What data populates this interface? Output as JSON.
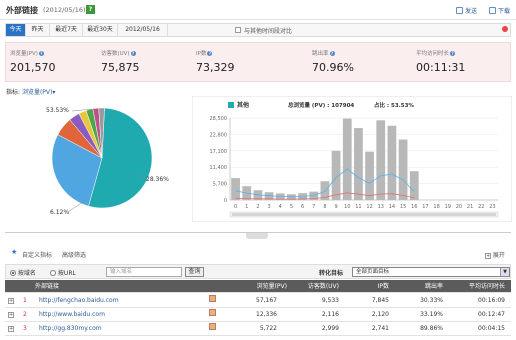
{
  "header": {
    "title": "外部链接",
    "date": "(2012/05/16)",
    "help": "?",
    "send": "发送",
    "download": "下载"
  },
  "datebar": {
    "tabs": [
      "今天",
      "昨天",
      "最近7天",
      "最近30天",
      "2012/05/16"
    ],
    "active": 0,
    "compare_label": "与其他时间段对比"
  },
  "metrics": [
    {
      "label": "浏览量(PV)",
      "value": "201,570"
    },
    {
      "label": "访客数(UV)",
      "value": "75,875"
    },
    {
      "label": "IP数",
      "value": "73,329"
    },
    {
      "label": "跳出率",
      "value": "70.96%"
    },
    {
      "label": "平均访问时长",
      "value": "00:11:31"
    }
  ],
  "indicator": {
    "label": "指标:",
    "value": "浏览量(PV)▾"
  },
  "pie": {
    "labels": [
      "53.53%",
      "28.36%",
      "6.12%"
    ],
    "slices": [
      {
        "value": 53.53,
        "color": "#1faab0"
      },
      {
        "value": 28.36,
        "color": "#4fa6e0"
      },
      {
        "value": 6.12,
        "color": "#e0653a"
      },
      {
        "value": 3.5,
        "color": "#8a5cc0"
      },
      {
        "value": 2.5,
        "color": "#e8c53a"
      },
      {
        "value": 2.2,
        "color": "#4aa84a"
      },
      {
        "value": 1.9,
        "color": "#c0508a"
      },
      {
        "value": 1.83,
        "color": "#9a9a9a"
      }
    ]
  },
  "chart_data": {
    "type": "bar",
    "legend": {
      "name": "其他",
      "total_label": "总浏览量 (PV) : 107904",
      "share_label": "占比 : 53.53%"
    },
    "ylim": [
      0,
      28500
    ],
    "yticks": [
      "28,500",
      "22,800",
      "17,100",
      "11,400",
      "5,700",
      "0"
    ],
    "categories": [
      "0",
      "1",
      "2",
      "3",
      "4",
      "5",
      "6",
      "7",
      "8",
      "9",
      "10",
      "11",
      "12",
      "13",
      "14",
      "15",
      "16",
      "17",
      "18",
      "19",
      "20",
      "21",
      "22",
      "23"
    ],
    "values": [
      7600,
      4800,
      3400,
      2700,
      2300,
      2000,
      2400,
      2900,
      6500,
      17100,
      28300,
      25000,
      16800,
      27700,
      25800,
      21000,
      10000,
      0,
      0,
      0,
      0,
      0,
      0,
      0
    ],
    "series": [
      {
        "name": "line-blue",
        "color": "#58b0e8",
        "values": [
          3200,
          2400,
          1800,
          1500,
          1200,
          1100,
          1200,
          1600,
          3000,
          7800,
          10800,
          7800,
          5800,
          8400,
          9000,
          7000,
          2800,
          0,
          0,
          0,
          0,
          0,
          0,
          0
        ]
      },
      {
        "name": "line-red",
        "color": "#e07070",
        "values": [
          600,
          500,
          400,
          400,
          300,
          300,
          400,
          500,
          900,
          1800,
          2500,
          2000,
          1500,
          2100,
          2200,
          1600,
          700,
          0,
          0,
          0,
          0,
          0,
          0,
          0
        ]
      }
    ]
  },
  "config": {
    "custom": "自定义指标",
    "filter": "高级筛选",
    "expand": "展开"
  },
  "filter": {
    "by_domain": "按域名",
    "by_url": "按URL",
    "placeholder": "输入域名",
    "query": "查询",
    "goal_label": "转化目标",
    "goal_value": "全部页面目标"
  },
  "table": {
    "headers": [
      "外部链接",
      "浏览量(PV)",
      "访客数(UV)",
      "IP数",
      "跳出率",
      "平均访问时长"
    ],
    "rows": [
      {
        "idx": "1",
        "url": "http://fengchao.baidu.com",
        "pv": "57,167",
        "uv": "9,533",
        "ip": "7,845",
        "bounce": "30.33%",
        "time": "00:16:09"
      },
      {
        "idx": "2",
        "url": "http://www.baidu.com",
        "pv": "12,336",
        "uv": "2,116",
        "ip": "2,120",
        "bounce": "33.19%",
        "time": "00:12:47"
      },
      {
        "idx": "3",
        "url": "http://gg.830my.com",
        "pv": "5,722",
        "uv": "2,999",
        "ip": "2,741",
        "bounce": "89.86%",
        "time": "00:04:15"
      }
    ]
  }
}
